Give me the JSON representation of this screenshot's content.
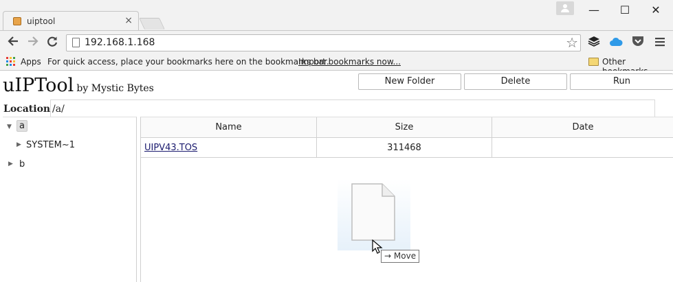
{
  "browser": {
    "tab": {
      "title": "uiptool",
      "close_glyph": "×"
    },
    "window_controls": {
      "minimize": "—",
      "maximize": "☐",
      "close": "✕"
    },
    "address": {
      "url": "192.168.1.168"
    },
    "bookmarks_bar": {
      "apps_label": "Apps",
      "hint": "For quick access, place your bookmarks here on the bookmarks bar.",
      "import_link": "Import bookmarks now...",
      "other_bookmarks": "Other bookmarks"
    }
  },
  "app": {
    "title": "uIPTool",
    "byline": "by Mystic Bytes",
    "buttons": {
      "new_folder": "New Folder",
      "delete": "Delete",
      "run": "Run"
    },
    "location": {
      "label": "Location:",
      "value": "/a/"
    },
    "tree": {
      "items": [
        {
          "label": "a",
          "expanded": true,
          "selected": true
        },
        {
          "label": "SYSTEM~1",
          "expanded": false,
          "selected": false
        },
        {
          "label": "b",
          "expanded": false,
          "selected": false
        }
      ]
    },
    "file_table": {
      "headers": {
        "name": "Name",
        "size": "Size",
        "date": "Date"
      },
      "rows": [
        {
          "name": "UIPV43.TOS",
          "size": "311468",
          "date": ""
        }
      ]
    },
    "drag": {
      "tooltip": "Move",
      "tooltip_arrow": "→"
    }
  },
  "colors": {
    "chrome_bg": "#f2f2f2",
    "link": "#1a1a6e",
    "selected_bg": "#e0e0e0"
  }
}
